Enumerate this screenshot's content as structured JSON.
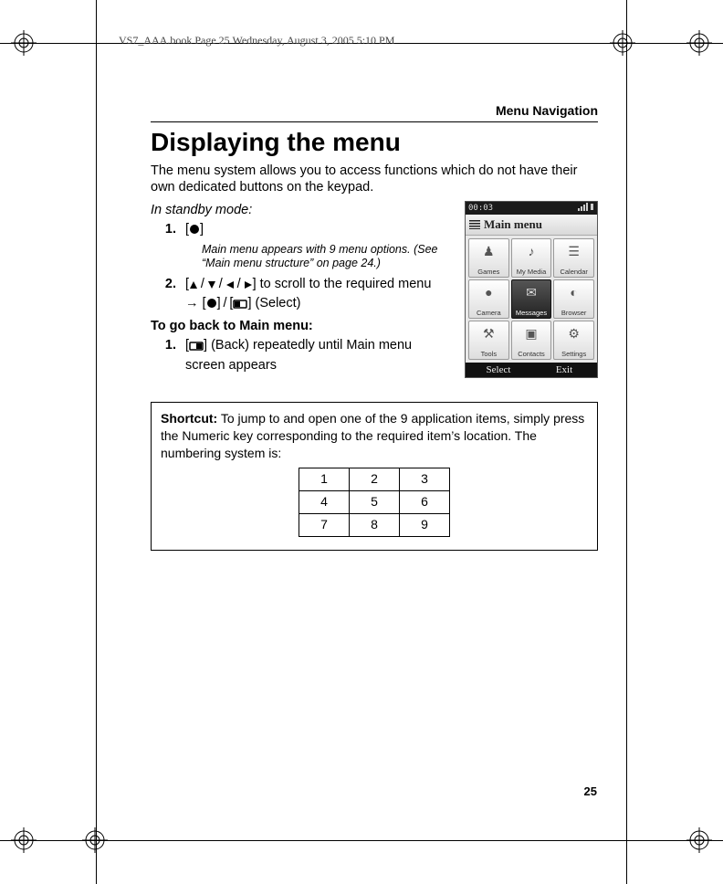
{
  "doc_header": "VS7_AAA.book  Page 25  Wednesday, August 3, 2005  5:10 PM",
  "breadcrumb": "Menu Navigation",
  "title": "Displaying the menu",
  "intro": "The menu system allows you to access functions which do not have their own dedicated buttons on the keypad.",
  "mode_line": "In standby mode:",
  "steps1": {
    "s1_num": "1.",
    "s1_open": "[",
    "s1_close": "]",
    "s1_note": "Main menu appears with 9 menu options. (See “Main menu structure” on page 24.)",
    "s2_num": "2.",
    "s2_pre": "[",
    "s2_mid": "] to scroll to the required menu → [",
    "s2_sep": "] / [",
    "s2_end": "] (Select)"
  },
  "subheading": "To go back to Main menu:",
  "steps2": {
    "s1_num": "1.",
    "s1_pre": "[",
    "s1_end": "] (Back) repeatedly until Main menu screen appears"
  },
  "phone": {
    "status_time": "00:03",
    "title": "Main menu",
    "cells": [
      {
        "label": "Games",
        "glyph": "♟"
      },
      {
        "label": "My Media",
        "glyph": "♪"
      },
      {
        "label": "Calendar",
        "glyph": "☰"
      },
      {
        "label": "Camera",
        "glyph": "●"
      },
      {
        "label": "Messages",
        "glyph": "✉",
        "sel": true
      },
      {
        "label": "Browser",
        "glyph": "◐"
      },
      {
        "label": "Tools",
        "glyph": "⚒"
      },
      {
        "label": "Contacts",
        "glyph": "▣"
      },
      {
        "label": "Settings",
        "glyph": "⚙"
      }
    ],
    "softkey_left": "Select",
    "softkey_right": "Exit"
  },
  "shortcut": {
    "label": "Shortcut:",
    "text": "   To jump to and open one of the 9 application items, simply press the Numeric key corresponding to the required item’s location. The numbering system is:",
    "grid": [
      [
        "1",
        "2",
        "3"
      ],
      [
        "4",
        "5",
        "6"
      ],
      [
        "7",
        "8",
        "9"
      ]
    ]
  },
  "page_number": "25"
}
